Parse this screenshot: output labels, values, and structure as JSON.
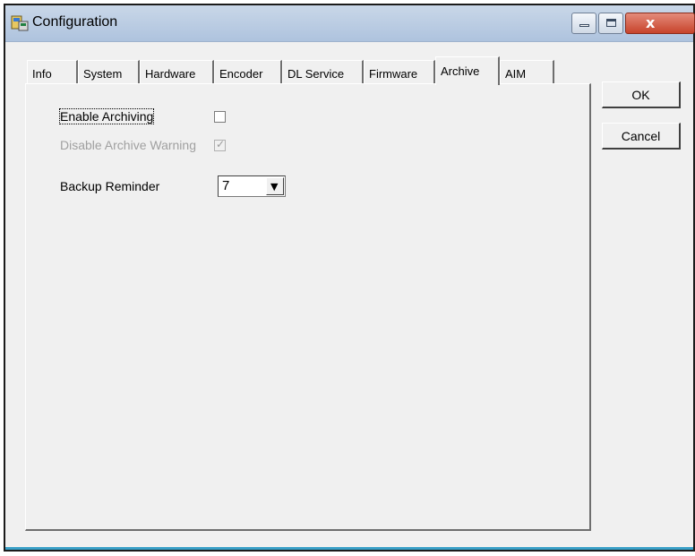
{
  "window": {
    "title": "Configuration"
  },
  "titlebar": {
    "minimize_icon": "minimize-icon",
    "maximize_icon": "maximize-icon",
    "close_icon": "close-icon",
    "close_glyph": "x"
  },
  "tabs": [
    "Info",
    "System",
    "Hardware",
    "Encoder",
    "DL Service",
    "Firmware",
    "Archive",
    "AIM"
  ],
  "active_tab": "Archive",
  "archive": {
    "enable_archiving_label": "Enable Archiving",
    "enable_archiving_checked": false,
    "disable_warning_label": "Disable Archive Warning",
    "disable_warning_checked": true,
    "disable_warning_enabled": false,
    "backup_reminder_label": "Backup Reminder",
    "backup_reminder_value": "7"
  },
  "buttons": {
    "ok": "OK",
    "cancel": "Cancel"
  }
}
